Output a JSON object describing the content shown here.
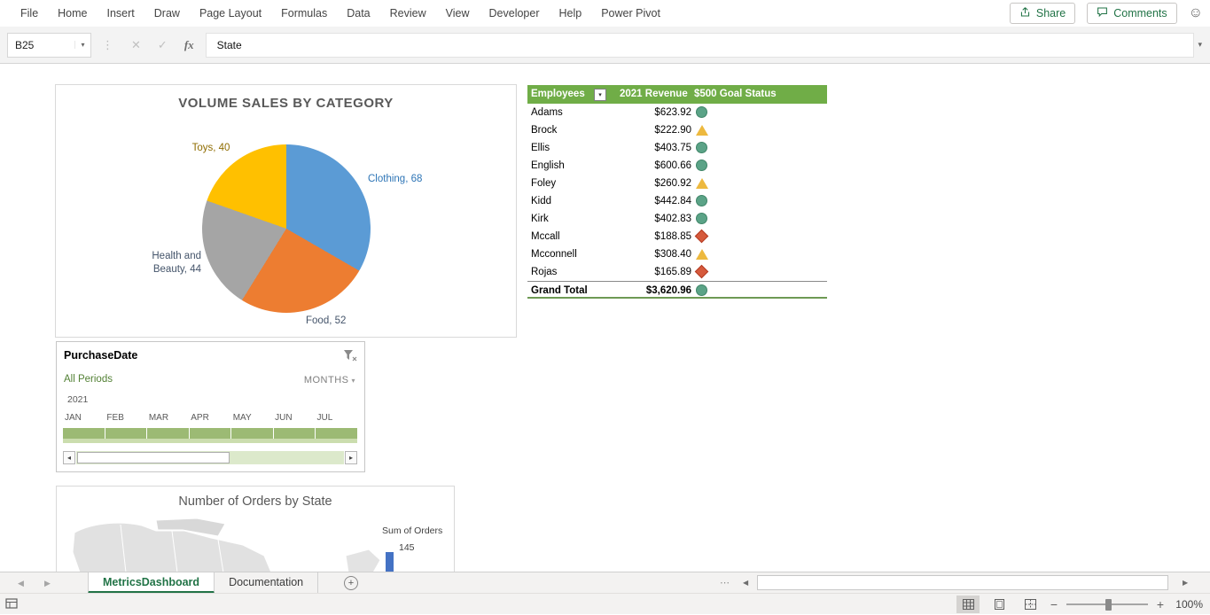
{
  "ribbon": {
    "tabs": [
      "File",
      "Home",
      "Insert",
      "Draw",
      "Page Layout",
      "Formulas",
      "Data",
      "Review",
      "View",
      "Developer",
      "Help",
      "Power Pivot"
    ],
    "share_label": "Share",
    "comments_label": "Comments"
  },
  "formula_bar": {
    "name_box_value": "B25",
    "formula_value": "State",
    "fx_label": "fx"
  },
  "chart_data": [
    {
      "type": "pie",
      "title": "VOLUME SALES BY CATEGORY",
      "categories": [
        "Clothing",
        "Food",
        "Health and Beauty",
        "Toys"
      ],
      "values": [
        68,
        52,
        44,
        40
      ],
      "colors": [
        "#5B9BD5",
        "#ED7D31",
        "#A5A5A5",
        "#FFC000"
      ],
      "labels": [
        "Clothing, 68",
        "Food, 52",
        "Health and Beauty, 44",
        "Toys, 40"
      ],
      "label_colors": [
        "#2E75B6",
        "#44546A",
        "#44546A",
        "#8F6C00"
      ],
      "legend_position": "none"
    },
    {
      "type": "bar",
      "title": "Number of Orders by State",
      "ylabel": "Sum of Orders",
      "note": "chart partially visible at bottom of sheet; US state map and first bar shown",
      "visible_values": [
        145
      ],
      "bar_color": "#4472C4"
    }
  ],
  "employee_table": {
    "header_employees": "Employees",
    "header_revenue": "2021 Revenue",
    "header_status": "$500 Goal Status",
    "header_color": "#70AD47",
    "rows": [
      {
        "name": "Adams",
        "revenue": "$623.92",
        "status": "green-circle"
      },
      {
        "name": "Brock",
        "revenue": "$222.90",
        "status": "yellow-triangle"
      },
      {
        "name": "Ellis",
        "revenue": "$403.75",
        "status": "green-circle"
      },
      {
        "name": "English",
        "revenue": "$600.66",
        "status": "green-circle"
      },
      {
        "name": "Foley",
        "revenue": "$260.92",
        "status": "yellow-triangle"
      },
      {
        "name": "Kidd",
        "revenue": "$442.84",
        "status": "green-circle"
      },
      {
        "name": "Kirk",
        "revenue": "$402.83",
        "status": "green-circle"
      },
      {
        "name": "Mccall",
        "revenue": "$188.85",
        "status": "red-diamond"
      },
      {
        "name": "Mcconnell",
        "revenue": "$308.40",
        "status": "yellow-triangle"
      },
      {
        "name": "Rojas",
        "revenue": "$165.89",
        "status": "red-diamond"
      }
    ],
    "total_row": {
      "name": "Grand Total",
      "revenue": "$3,620.96",
      "status": "green-circle"
    }
  },
  "timeline": {
    "title": "PurchaseDate",
    "selection_label": "All Periods",
    "level_label": "MONTHS",
    "year_label": "2021",
    "months": [
      "JAN",
      "FEB",
      "MAR",
      "APR",
      "MAY",
      "JUN",
      "JUL"
    ],
    "selected_fill": "#9CBA74"
  },
  "orders_chart": {
    "title": "Number of Orders by State",
    "axis_label": "Sum of Orders",
    "first_value": "145"
  },
  "sheet_bar": {
    "tabs": [
      {
        "label": "MetricsDashboard",
        "active": true
      },
      {
        "label": "Documentation",
        "active": false
      }
    ]
  },
  "status_bar": {
    "zoom_value": "100%"
  },
  "colors": {
    "excel_green": "#217346"
  }
}
